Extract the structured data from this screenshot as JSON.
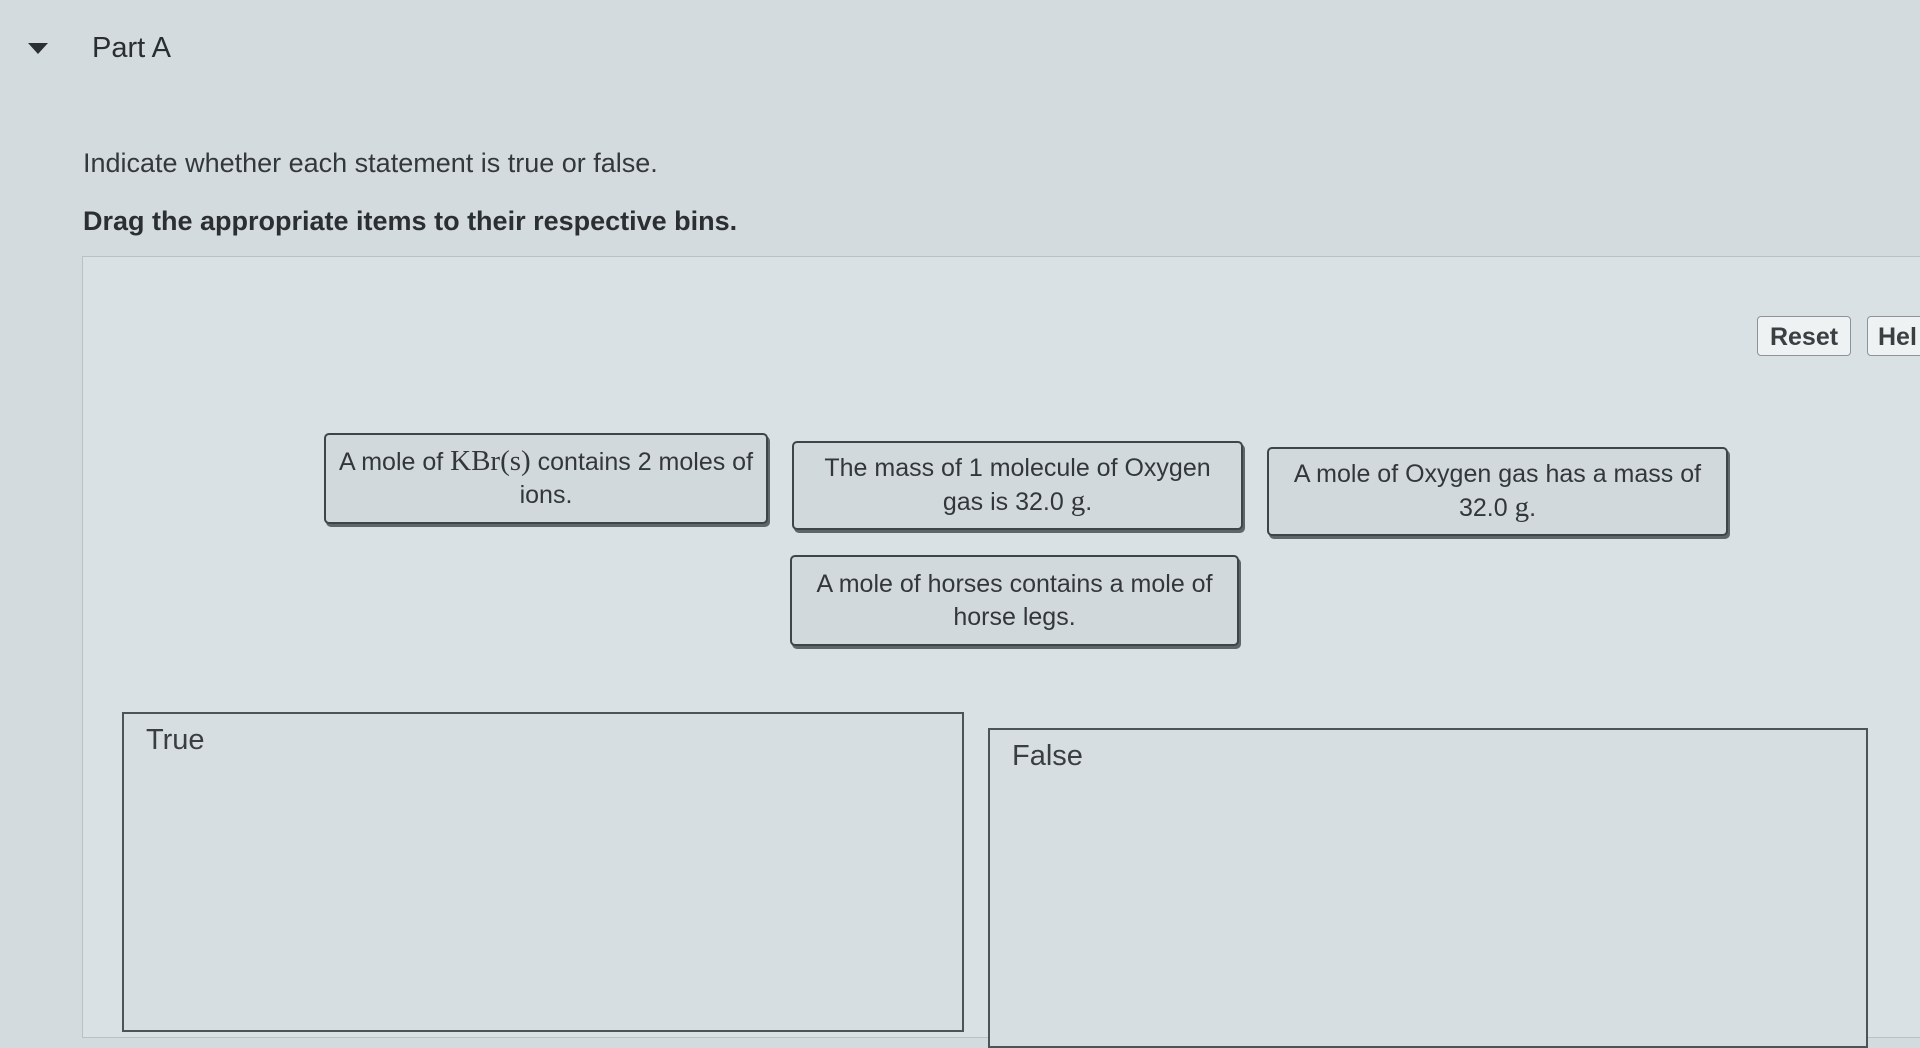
{
  "part": {
    "title": "Part A",
    "caret_icon": "triangle-down-icon"
  },
  "instructions": {
    "line1": "Indicate whether each statement is true or false.",
    "line2": "Drag the appropriate items to their respective bins."
  },
  "toolbar": {
    "reset_label": "Reset",
    "help_label": "Hel"
  },
  "cards": [
    {
      "prefix": "A mole of ",
      "math": "KBr(s)",
      "suffix": " contains 2 moles of ions."
    },
    {
      "prefix": "The mass of 1 molecule of Oxygen gas is 32.0 ",
      "math": "g",
      "suffix": "."
    },
    {
      "prefix": "A mole of Oxygen gas has a mass of 32.0 ",
      "math": "g",
      "suffix": "."
    },
    {
      "prefix": "A mole of horses contains a mole of horse legs.",
      "math": "",
      "suffix": ""
    }
  ],
  "bins": {
    "true_label": "True",
    "false_label": "False"
  },
  "colors": {
    "background": "#d3dbdf",
    "card_background": "#d1d9dd",
    "card_border": "#3f4448"
  }
}
